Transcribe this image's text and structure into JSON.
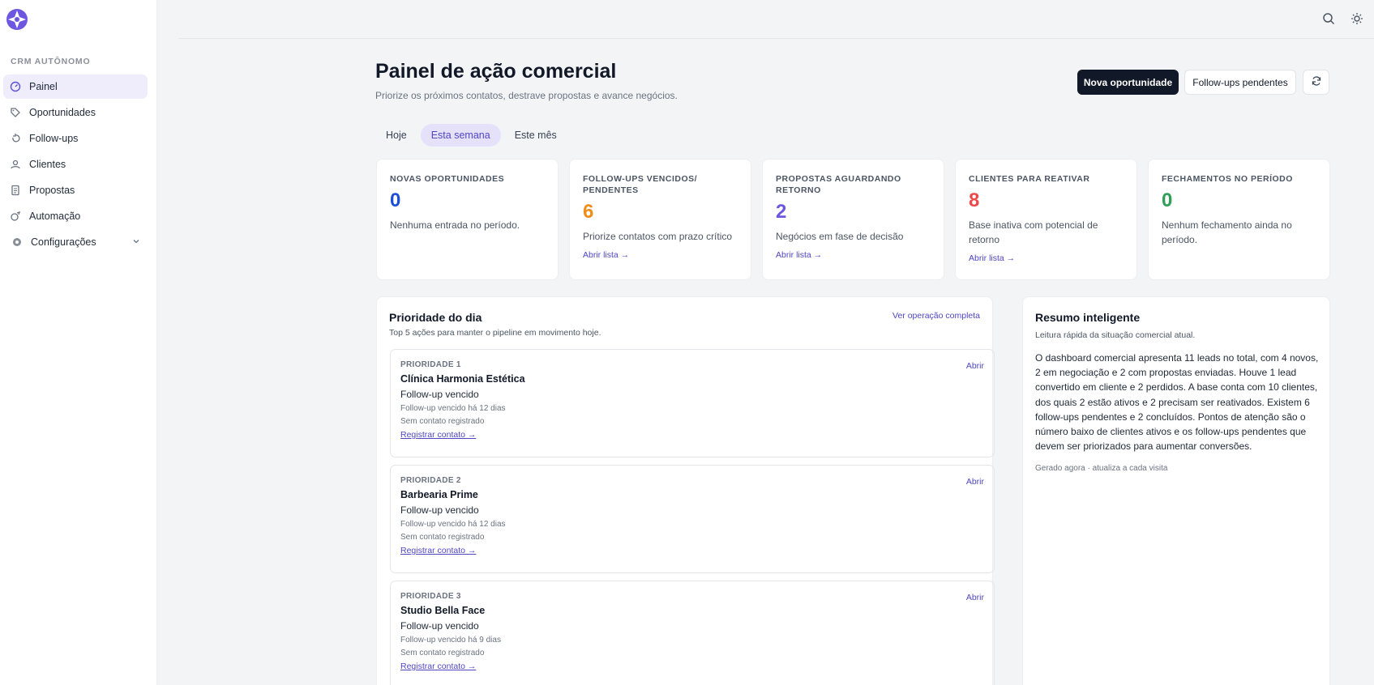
{
  "sidebar": {
    "section_label": "CRM AUTÔNOMO",
    "items": [
      {
        "label": "Painel",
        "icon": "dashboard-icon",
        "active": true
      },
      {
        "label": "Oportunidades",
        "icon": "tag-icon"
      },
      {
        "label": "Follow-ups",
        "icon": "follow-up-icon"
      },
      {
        "label": "Clientes",
        "icon": "user-icon"
      },
      {
        "label": "Propostas",
        "icon": "document-icon"
      },
      {
        "label": "Automação",
        "icon": "automation-icon"
      }
    ],
    "config": {
      "label": "Configurações",
      "icon": "gear-icon"
    }
  },
  "header": {
    "title": "Painel de ação comercial",
    "subtitle": "Priorize os próximos contatos, destrave propostas e avance negócios.",
    "primary_button": "Nova oportunidade",
    "secondary_button": "Follow-ups pendentes"
  },
  "tabs": [
    {
      "label": "Hoje"
    },
    {
      "label": "Esta semana",
      "active": true
    },
    {
      "label": "Este mês"
    }
  ],
  "kpis": [
    {
      "label": "NOVAS OPORTUNIDADES",
      "value": "0",
      "color": "#1d4ed8",
      "desc": "Nenhuma entrada no período.",
      "link": ""
    },
    {
      "label": "FOLLOW-UPS VENCIDOS/ PENDENTES",
      "value": "6",
      "color": "#f08c1a",
      "desc": "Priorize contatos com prazo crítico",
      "link": "Abrir lista →"
    },
    {
      "label": "PROPOSTAS AGUARDANDO RETORNO",
      "value": "2",
      "color": "#6d56e0",
      "desc": "Negócios em fase de decisão",
      "link": "Abrir lista →"
    },
    {
      "label": "CLIENTES PARA REATIVAR",
      "value": "8",
      "color": "#ea4a4a",
      "desc": "Base inativa com potencial de retorno",
      "link": "Abrir lista →"
    },
    {
      "label": "FECHAMENTOS NO PERÍODO",
      "value": "0",
      "color": "#2f9e57",
      "desc": "Nenhum fechamento ainda no período.",
      "link": ""
    }
  ],
  "priority": {
    "title": "Prioridade do dia",
    "subtitle": "Top 5 ações para manter o pipeline em movimento hoje.",
    "link": "Ver operação completa",
    "open_label": "Abrir",
    "items": [
      {
        "rank": "PRIORIDADE 1",
        "name": "Clínica Harmonia Estética",
        "type": "Follow-up vencido",
        "due": "Follow-up vencido há 12 dias",
        "contact": "Sem contato registrado",
        "action": "Registrar contato →"
      },
      {
        "rank": "PRIORIDADE 2",
        "name": "Barbearia Prime",
        "type": "Follow-up vencido",
        "due": "Follow-up vencido há 12 dias",
        "contact": "Sem contato registrado",
        "action": "Registrar contato →"
      },
      {
        "rank": "PRIORIDADE 3",
        "name": "Studio Bella Face",
        "type": "Follow-up vencido",
        "due": "Follow-up vencido há 9 dias",
        "contact": "Sem contato registrado",
        "action": "Registrar contato →"
      }
    ]
  },
  "summary": {
    "title": "Resumo inteligente",
    "subtitle": "Leitura rápida da situação comercial atual.",
    "body": "O dashboard comercial apresenta 11 leads no total, com 4 novos, 2 em negociação e 2 com propostas enviadas. Houve 1 lead convertido em cliente e 2 perdidos. A base conta com 10 clientes, dos quais 2 estão ativos e 2 precisam ser reativados. Existem 6 follow-ups pendentes e 2 concluídos. Pontos de atenção são o número baixo de clientes ativos e os follow-ups pendentes que devem ser priorizados para aumentar conversões.",
    "footer": "Gerado agora · atualiza a cada visita"
  },
  "colors": {
    "accent": "#4f46c4",
    "primary_button": "#111827",
    "active_nav_bg": "#efecfb"
  }
}
